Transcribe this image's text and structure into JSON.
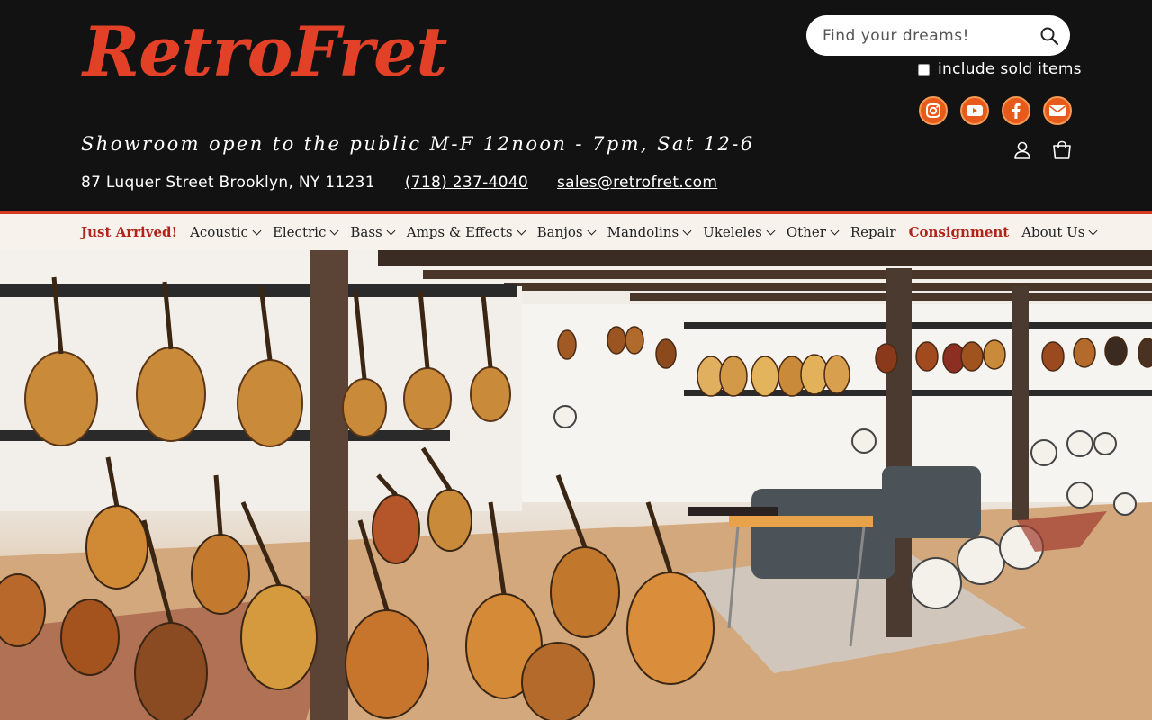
{
  "brand": {
    "logo_part1": "Retro",
    "logo_part2": "Fret",
    "brand_red": "#e24128",
    "header_bg": "#121212",
    "nav_bg": "#f7f2ec"
  },
  "search": {
    "placeholder": "Find your dreams!",
    "value": "",
    "include_sold_label": "include sold items",
    "include_sold_checked": false
  },
  "social_icons": [
    "instagram-icon",
    "youtube-icon",
    "facebook-icon",
    "email-icon"
  ],
  "info": {
    "showroom": "Showroom open to the public M-F 12noon - 7pm, Sat 12-6",
    "address": "87 Luquer Street Brooklyn, NY 11231",
    "phone": "(718) 237-4040",
    "email": "sales@retrofret.com"
  },
  "nav": {
    "items": [
      {
        "label": "Just Arrived!",
        "dropdown": false,
        "highlight": true
      },
      {
        "label": "Acoustic",
        "dropdown": true,
        "highlight": false
      },
      {
        "label": "Electric",
        "dropdown": true,
        "highlight": false
      },
      {
        "label": "Bass",
        "dropdown": true,
        "highlight": false
      },
      {
        "label": "Amps & Effects",
        "dropdown": true,
        "highlight": false
      },
      {
        "label": "Banjos",
        "dropdown": true,
        "highlight": false
      },
      {
        "label": "Mandolins",
        "dropdown": true,
        "highlight": false
      },
      {
        "label": "Ukeleles",
        "dropdown": true,
        "highlight": false
      },
      {
        "label": "Other",
        "dropdown": true,
        "highlight": false
      },
      {
        "label": "Repair",
        "dropdown": false,
        "highlight": false
      },
      {
        "label": "Consignment",
        "dropdown": false,
        "highlight": true
      },
      {
        "label": "About Us",
        "dropdown": true,
        "highlight": false
      }
    ]
  },
  "hero": {
    "image_alt": "Retrofret showroom with guitars, mandolins and banjos"
  }
}
